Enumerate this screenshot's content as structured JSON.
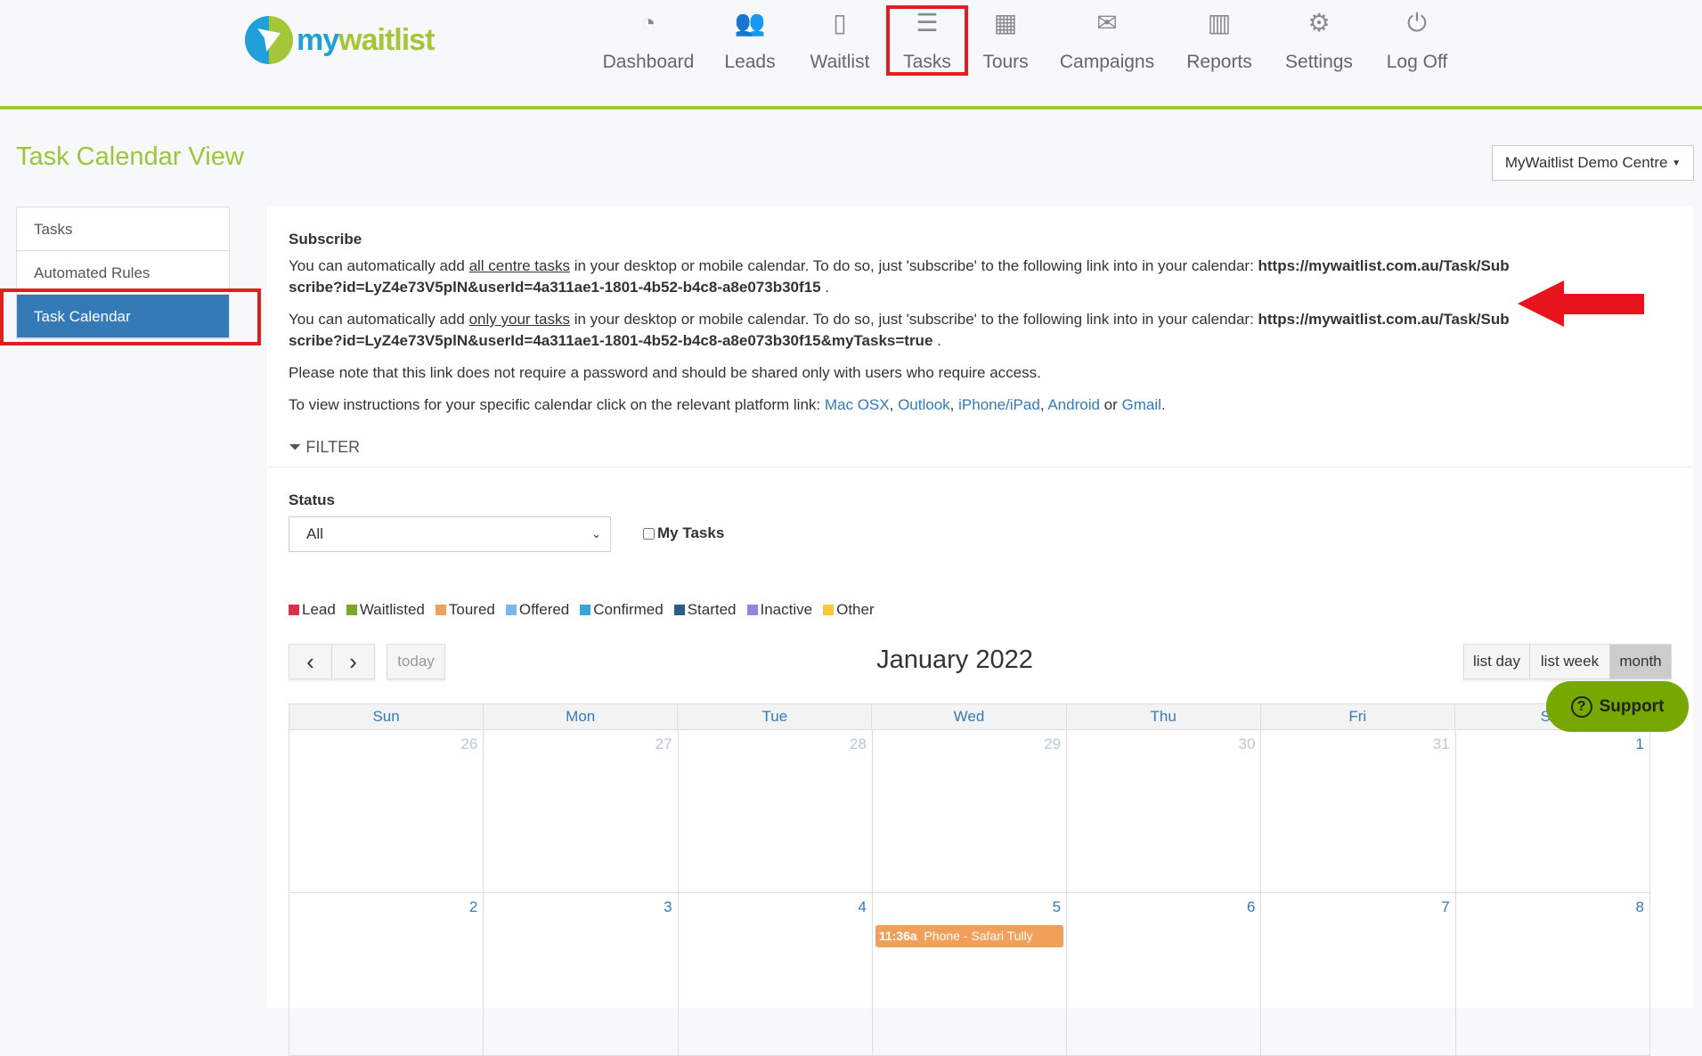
{
  "brand": {
    "part1": "my",
    "part2": "waitlist"
  },
  "nav": [
    {
      "label": "Dashboard",
      "icon": "dashboard-icon",
      "glyph": "◔"
    },
    {
      "label": "Leads",
      "icon": "users-icon",
      "glyph": "👥"
    },
    {
      "label": "Waitlist",
      "icon": "document-icon",
      "glyph": "▯"
    },
    {
      "label": "Tasks",
      "icon": "tasks-icon",
      "glyph": "☰"
    },
    {
      "label": "Tours",
      "icon": "calendar-icon",
      "glyph": "▦"
    },
    {
      "label": "Campaigns",
      "icon": "envelope-icon",
      "glyph": "✉"
    },
    {
      "label": "Reports",
      "icon": "bar-chart-icon",
      "glyph": "▥"
    },
    {
      "label": "Settings",
      "icon": "gears-icon",
      "glyph": "⚙"
    },
    {
      "label": "Log Off",
      "icon": "power-icon",
      "glyph": "⏻"
    }
  ],
  "page_title": "Task Calendar View",
  "centre_select": "MyWaitlist Demo Centre",
  "sidebar": [
    {
      "label": "Tasks"
    },
    {
      "label": "Automated Rules"
    },
    {
      "label": "Task Calendar"
    }
  ],
  "subscribe": {
    "heading": "Subscribe",
    "p1_pre": "You can automatically add ",
    "p1_link": "all centre tasks",
    "p1_post": " in your desktop or mobile calendar. To do so, just 'subscribe' to the following link into in your calendar: ",
    "p1_url": "https://mywaitlist.com.au/Task/Subscribe?id=LyZ4e73V5plN&userId=4a311ae1-1801-4b52-b4c8-a8e073b30f15",
    "p2_pre": "You can automatically add ",
    "p2_link": "only your tasks",
    "p2_post": " in your desktop or mobile calendar. To do so, just 'subscribe' to the following link into in your calendar: ",
    "p2_url": "https://mywaitlist.com.au/Task/Subscribe?id=LyZ4e73V5plN&userId=4a311ae1-1801-4b52-b4c8-a8e073b30f15&myTasks=true",
    "note": "Please note that this link does not require a password and should be shared only with users who require access.",
    "instr_pre": "To view instructions for your specific calendar click on the relevant platform link: ",
    "links": [
      "Mac OSX",
      "Outlook",
      "iPhone/iPad",
      "Android",
      "Gmail"
    ],
    "or": " or "
  },
  "filter": {
    "label": "FILTER",
    "status_label": "Status",
    "status_value": "All",
    "my_tasks": "My Tasks",
    "my_tasks_checked": false
  },
  "legend": [
    {
      "label": "Lead",
      "color": "#d9304f"
    },
    {
      "label": "Waitlisted",
      "color": "#76a82a"
    },
    {
      "label": "Toured",
      "color": "#f0a05a"
    },
    {
      "label": "Offered",
      "color": "#7ab8ee"
    },
    {
      "label": "Confirmed",
      "color": "#3aa3d8"
    },
    {
      "label": "Started",
      "color": "#2a5a8a"
    },
    {
      "label": "Inactive",
      "color": "#8a88e0"
    },
    {
      "label": "Other",
      "color": "#f8c83a"
    }
  ],
  "calendar": {
    "title": "January 2022",
    "today": "today",
    "prev": "‹",
    "next": "›",
    "views": [
      "list day",
      "list week",
      "month"
    ],
    "active_view": "month",
    "days": [
      "Sun",
      "Mon",
      "Tue",
      "Wed",
      "Thu",
      "Fri",
      "Sat"
    ],
    "weeks": [
      [
        {
          "n": "26",
          "other": true
        },
        {
          "n": "27",
          "other": true
        },
        {
          "n": "28",
          "other": true
        },
        {
          "n": "29",
          "other": true
        },
        {
          "n": "30",
          "other": true
        },
        {
          "n": "31",
          "other": true
        },
        {
          "n": "1"
        }
      ],
      [
        {
          "n": "2"
        },
        {
          "n": "3"
        },
        {
          "n": "4"
        },
        {
          "n": "5",
          "event": {
            "time": "11:36a",
            "title": "Phone - Safari Tully"
          }
        },
        {
          "n": "6"
        },
        {
          "n": "7"
        },
        {
          "n": "8"
        }
      ]
    ]
  },
  "support": "Support"
}
